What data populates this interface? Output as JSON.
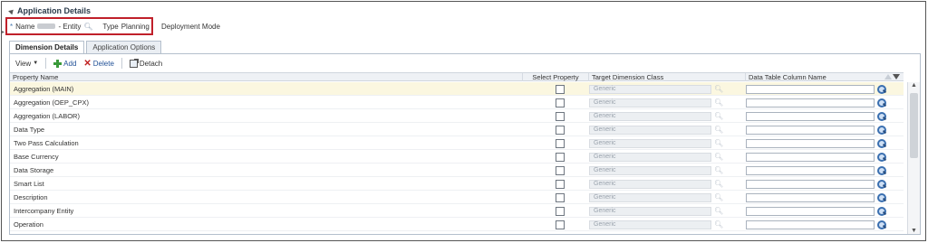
{
  "header": {
    "title": "Application Details",
    "name_label": "Name",
    "entity_text": "- Entity",
    "type_label": "Type",
    "type_value": "Planning",
    "deployment_mode_label": "Deployment Mode"
  },
  "tabs": [
    {
      "label": "Dimension Details",
      "active": true
    },
    {
      "label": "Application Options",
      "active": false
    }
  ],
  "toolbar": {
    "view_label": "View",
    "add_label": "Add",
    "delete_label": "Delete",
    "detach_label": "Detach"
  },
  "columns": {
    "property_name": "Property Name",
    "select_property": "Select Property",
    "target_dimension_class": "Target Dimension Class",
    "data_table_column_name": "Data Table Column Name"
  },
  "rows": [
    {
      "name": "Aggregation (MAIN)",
      "class": "Generic",
      "selected": true
    },
    {
      "name": "Aggregation (OEP_CPX)",
      "class": "Generic",
      "selected": false
    },
    {
      "name": "Aggregation (LABOR)",
      "class": "Generic",
      "selected": false
    },
    {
      "name": "Data Type",
      "class": "Generic",
      "selected": false
    },
    {
      "name": "Two Pass Calculation",
      "class": "Generic",
      "selected": false
    },
    {
      "name": "Base Currency",
      "class": "Generic",
      "selected": false
    },
    {
      "name": "Data Storage",
      "class": "Generic",
      "selected": false
    },
    {
      "name": "Smart List",
      "class": "Generic",
      "selected": false
    },
    {
      "name": "Description",
      "class": "Generic",
      "selected": false
    },
    {
      "name": "Intercompany Entity",
      "class": "Generic",
      "selected": false
    },
    {
      "name": "Operation",
      "class": "Generic",
      "selected": false
    }
  ],
  "colors": {
    "highlight_box": "#c0202a",
    "selected_row": "#fbf7e0",
    "link": "#1f4f96"
  }
}
